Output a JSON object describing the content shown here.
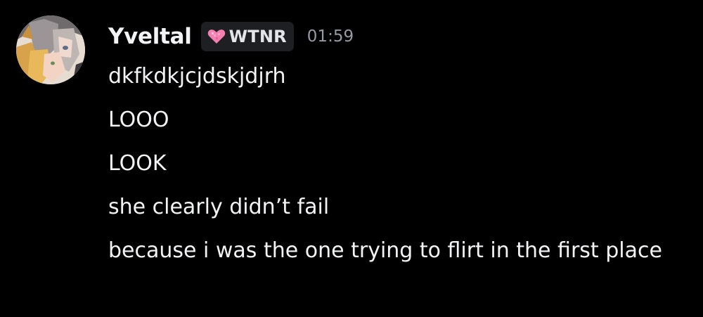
{
  "message": {
    "author": {
      "username": "Yveltal",
      "tag_label": "WTNR",
      "tag_icon": "pink-heart-icon",
      "avatar": "anime-avatar"
    },
    "timestamp": "01:59",
    "lines": [
      "dkfkdkjcjdskjdjrh",
      "LOOO",
      "LOOK",
      "she clearly didn’t fail",
      "because i was the one trying to flirt in the first place"
    ]
  },
  "colors": {
    "background": "#000000",
    "text": "#f2f3f5",
    "timestamp": "#949ba4",
    "tag_background": "#1e1f22",
    "tag_icon": "#f47fb0"
  }
}
